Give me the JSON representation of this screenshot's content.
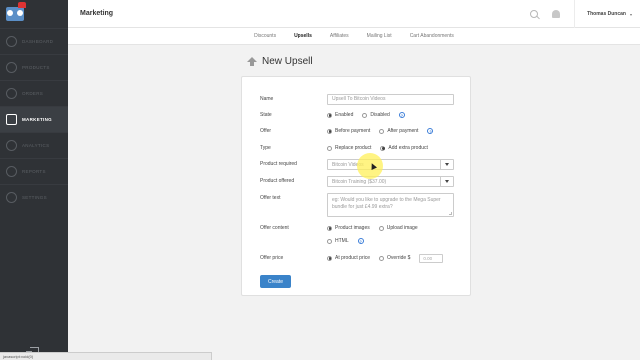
{
  "header": {
    "title": "Marketing",
    "user_name": "Thomas Duncan",
    "user_caret": "▾"
  },
  "sidebar": {
    "items": [
      {
        "label": "Dashboard",
        "icon": "dashboard-icon"
      },
      {
        "label": "Products",
        "icon": "tag-icon"
      },
      {
        "label": "Orders",
        "icon": "cart-icon"
      },
      {
        "label": "Marketing",
        "icon": "chat-icon"
      },
      {
        "label": "Analytics",
        "icon": "chart-icon"
      },
      {
        "label": "Reports",
        "icon": "report-icon"
      },
      {
        "label": "Settings",
        "icon": "gear-icon"
      }
    ]
  },
  "tabs": [
    "Discounts",
    "Upsells",
    "Affiliates",
    "Mailing List",
    "Cart Abandonments"
  ],
  "page": {
    "title": "New Upsell"
  },
  "form": {
    "name_label": "Name",
    "name_value": "Upsell To Bitcoin Videos",
    "state_label": "State",
    "state_options": [
      "Enabled",
      "Disabled"
    ],
    "offer_label": "Offer",
    "offer_options": [
      "Before payment",
      "After payment"
    ],
    "type_label": "Type",
    "type_options": [
      "Replace product",
      "Add extra product"
    ],
    "product_required_label": "Product required",
    "product_required_value": "Bitcoin Videos",
    "product_offered_label": "Product offered",
    "product_offered_value": "Bitcoin Training ($37.00)",
    "offer_text_label": "Offer text",
    "offer_text_placeholder": "eg: Would you like to upgrade to the Mega Super bundle for just £4.99 extra?",
    "offer_content_label": "Offer content",
    "offer_content_options": [
      "Product images",
      "Upload image",
      "HTML"
    ],
    "offer_price_label": "Offer price",
    "offer_price_options": [
      "At product price",
      "Override $"
    ],
    "offer_price_placeholder": "0.00",
    "help_glyph": "?",
    "create_label": "Create"
  },
  "statusbar": {
    "text": "javascript:void(0)"
  },
  "colors": {
    "sidebar": "#2f3236",
    "accent": "#3a83c9"
  }
}
